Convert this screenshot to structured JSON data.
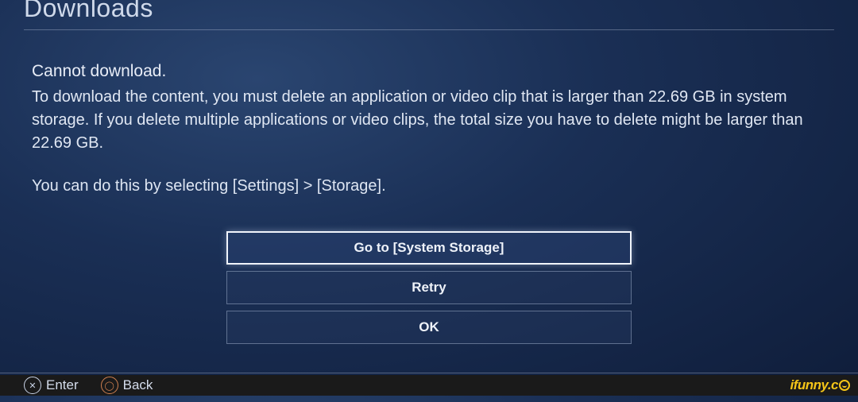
{
  "header": {
    "title": "Downloads"
  },
  "message": {
    "title": "Cannot download.",
    "body": "To download the content, you must delete an application or video clip that is larger than 22.69 GB in system storage. If you delete multiple applications or video clips, the total size you have to delete might be larger than 22.69 GB.",
    "hint": "You can do this by selecting [Settings] > [Storage]."
  },
  "buttons": {
    "goto_storage": "Go to [System Storage]",
    "retry": "Retry",
    "ok": "OK"
  },
  "footer": {
    "enter_label": "Enter",
    "back_label": "Back",
    "enter_glyph": "✕",
    "back_glyph": "◯"
  },
  "watermark": {
    "text": "ifunny.c"
  }
}
